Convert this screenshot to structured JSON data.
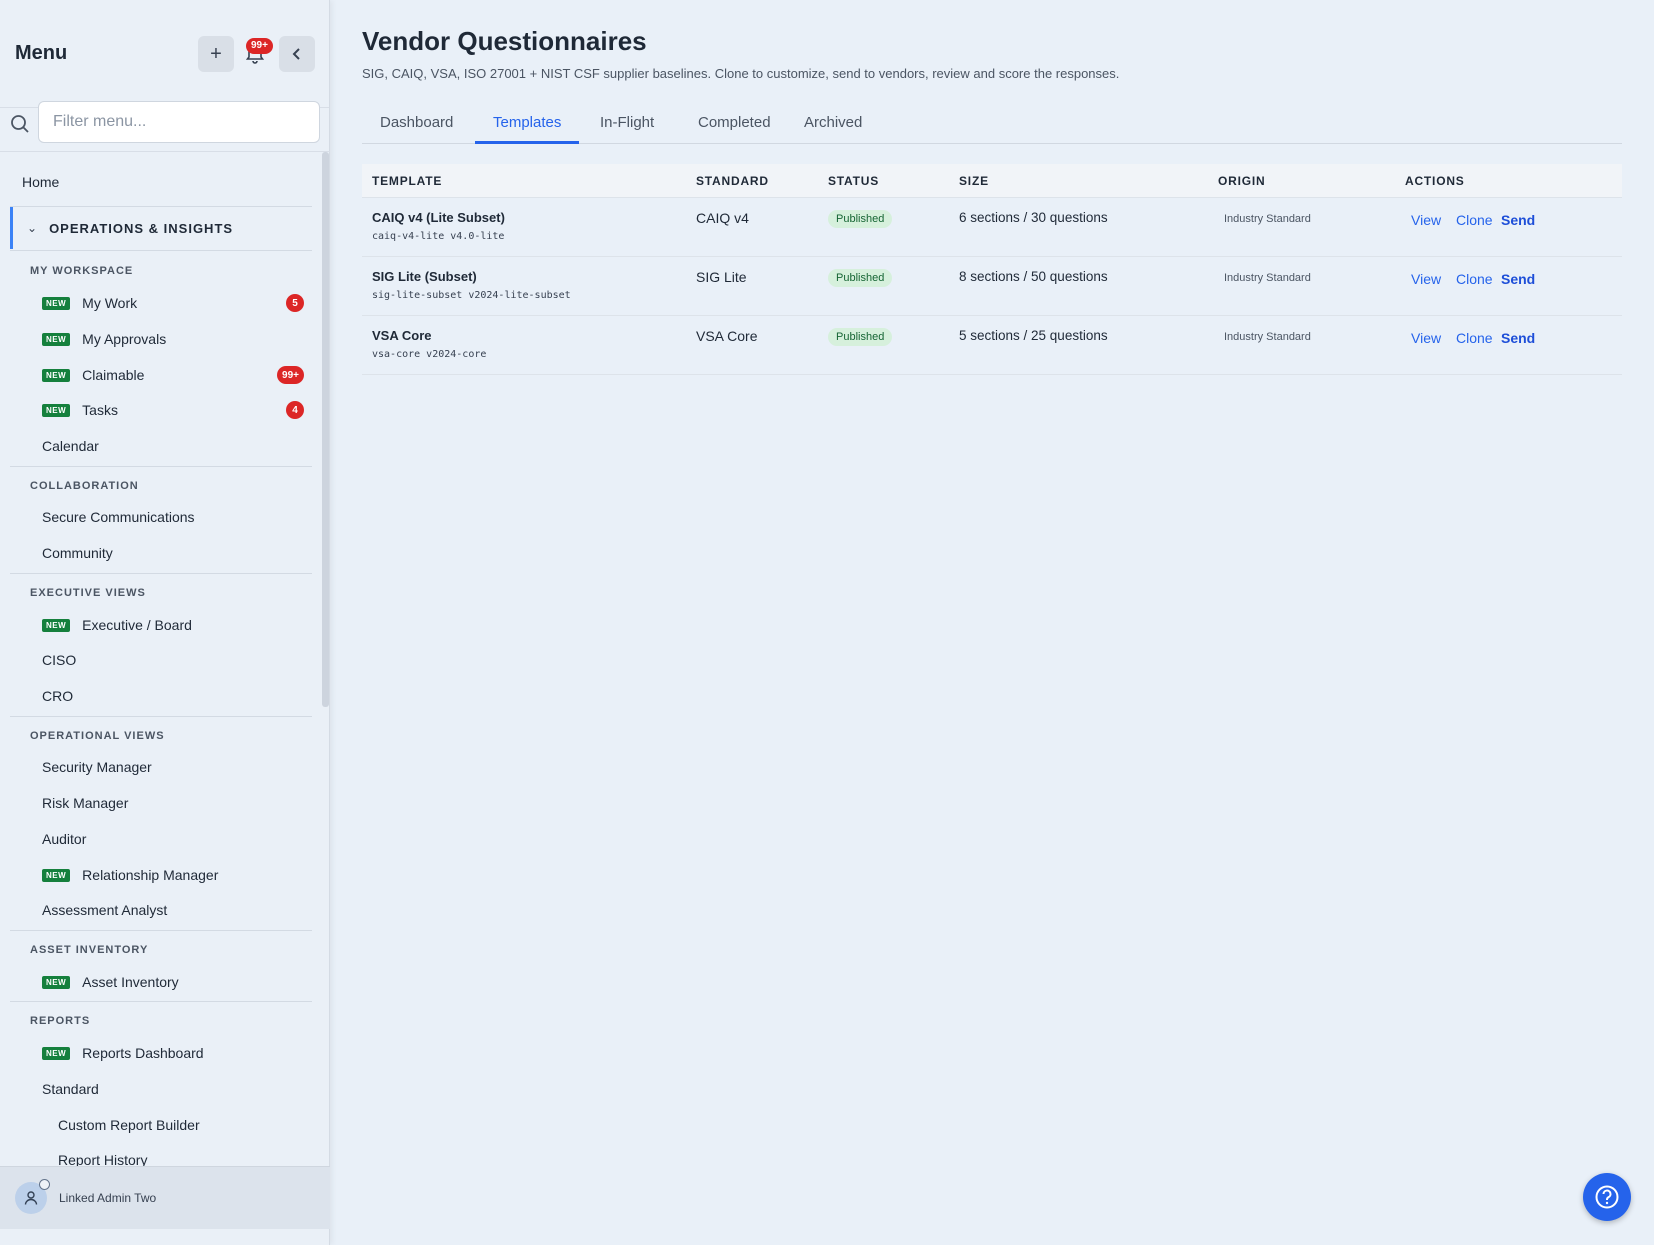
{
  "sidebar": {
    "title": "Menu",
    "notif_count": "99+",
    "search_placeholder": "Filter menu...",
    "home": "Home",
    "group_label": "OPERATIONS & INSIGHTS",
    "new_tag": "NEW",
    "sections": {
      "workspace": "MY WORKSPACE",
      "collaboration": "COLLABORATION",
      "executive": "EXECUTIVE VIEWS",
      "operational": "OPERATIONAL VIEWS",
      "asset": "ASSET INVENTORY",
      "reports": "REPORTS"
    },
    "items": {
      "my_work": "My Work",
      "my_work_count": "5",
      "my_approvals": "My Approvals",
      "claimable": "Claimable",
      "claimable_count": "99+",
      "tasks": "Tasks",
      "tasks_count": "4",
      "calendar": "Calendar",
      "secure_comms": "Secure Communications",
      "community": "Community",
      "exec_board": "Executive / Board",
      "ciso": "CISO",
      "cro": "CRO",
      "security_mgr": "Security Manager",
      "risk_mgr": "Risk Manager",
      "auditor": "Auditor",
      "relationship_mgr": "Relationship Manager",
      "assessment_analyst": "Assessment Analyst",
      "asset_inventory": "Asset Inventory",
      "reports_dashboard": "Reports Dashboard",
      "standard": "Standard",
      "custom_report_builder": "Custom Report Builder",
      "report_history": "Report History"
    },
    "user_name": "Linked Admin Two"
  },
  "main": {
    "title": "Vendor Questionnaires",
    "subtitle": "SIG, CAIQ, VSA, ISO 27001 + NIST CSF supplier baselines. Clone to customize, send to vendors, review and score the responses.",
    "tabs": [
      "Dashboard",
      "Templates",
      "In-Flight",
      "Completed",
      "Archived"
    ],
    "columns": [
      "TEMPLATE",
      "STANDARD",
      "STATUS",
      "SIZE",
      "ORIGIN",
      "ACTIONS"
    ],
    "actions": {
      "view": "View",
      "clone": "Clone",
      "send": "Send"
    },
    "rows": [
      {
        "name": "CAIQ v4 (Lite Subset)",
        "id": "caiq-v4-lite v4.0-lite",
        "standard": "CAIQ v4",
        "status": "Published",
        "size": "6 sections / 30 questions",
        "origin": "Industry Standard"
      },
      {
        "name": "SIG Lite (Subset)",
        "id": "sig-lite-subset v2024-lite-subset",
        "standard": "SIG Lite",
        "status": "Published",
        "size": "8 sections / 50 questions",
        "origin": "Industry Standard"
      },
      {
        "name": "VSA Core",
        "id": "vsa-core v2024-core",
        "standard": "VSA Core",
        "status": "Published",
        "size": "5 sections / 25 questions",
        "origin": "Industry Standard"
      }
    ]
  },
  "colors": {
    "accent": "#2563eb",
    "badge": "#dc2626",
    "new_tag": "#15803d",
    "status_bg": "#d6f0dc"
  }
}
